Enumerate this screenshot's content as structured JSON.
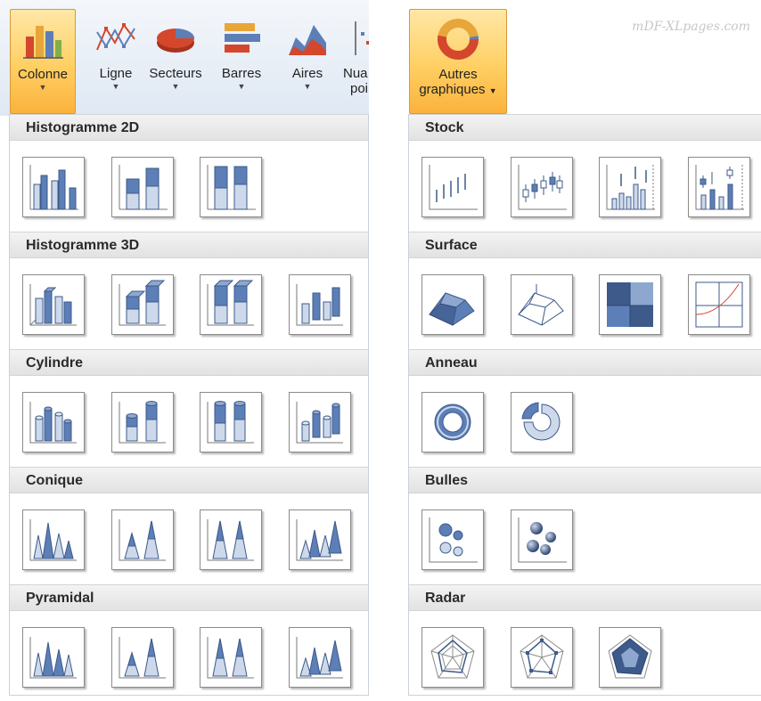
{
  "left": {
    "ribbon": [
      {
        "label": "Colonne",
        "label2": ""
      },
      {
        "label": "Ligne",
        "label2": ""
      },
      {
        "label": "Secteurs",
        "label2": ""
      },
      {
        "label": "Barres",
        "label2": ""
      },
      {
        "label": "Aires",
        "label2": ""
      },
      {
        "label": "Nua",
        "label2": "poi"
      }
    ],
    "sections": [
      {
        "title": "Histogramme 2D",
        "icons": [
          "histogramme-2d-groupe",
          "histogramme-2d-empile",
          "histogramme-2d-empile-100"
        ]
      },
      {
        "title": "Histogramme 3D",
        "icons": [
          "histogramme-3d-groupe",
          "histogramme-3d-empile",
          "histogramme-3d-empile-100",
          "histogramme-3d"
        ]
      },
      {
        "title": "Cylindre",
        "icons": [
          "cylindre-groupe",
          "cylindre-empile",
          "cylindre-empile-100",
          "cylindre-3d"
        ]
      },
      {
        "title": "Conique",
        "icons": [
          "conique-groupe",
          "conique-empile",
          "conique-empile-100",
          "conique-3d"
        ]
      },
      {
        "title": "Pyramidal",
        "icons": [
          "pyramide-groupe",
          "pyramide-empile",
          "pyramide-empile-100",
          "pyramide-3d"
        ]
      }
    ]
  },
  "right": {
    "ribbon": {
      "label": "Autres",
      "label2": "graphiques"
    },
    "watermark": "mDF-XLpages.com",
    "sections": [
      {
        "title": "Stock",
        "icons": [
          "stock-haut-bas-fermeture",
          "stock-ouverture-fermeture",
          "stock-volume-haut-bas",
          "stock-volume-ouverture"
        ]
      },
      {
        "title": "Surface",
        "icons": [
          "surface-3d",
          "surface-3d-filaire",
          "surface-contour",
          "surface-contour-filaire"
        ]
      },
      {
        "title": "Anneau",
        "icons": [
          "anneau",
          "anneau-eclate"
        ]
      },
      {
        "title": "Bulles",
        "icons": [
          "bulles",
          "bulles-3d"
        ]
      },
      {
        "title": "Radar",
        "icons": [
          "radar",
          "radar-marqueurs",
          "radar-rempli"
        ]
      }
    ]
  },
  "colors": {
    "accent_orange": "#fbb23c",
    "bar_blue": "#5d7fb7",
    "bar_light": "#cdd9ea",
    "outline": "#3d5a8a"
  }
}
